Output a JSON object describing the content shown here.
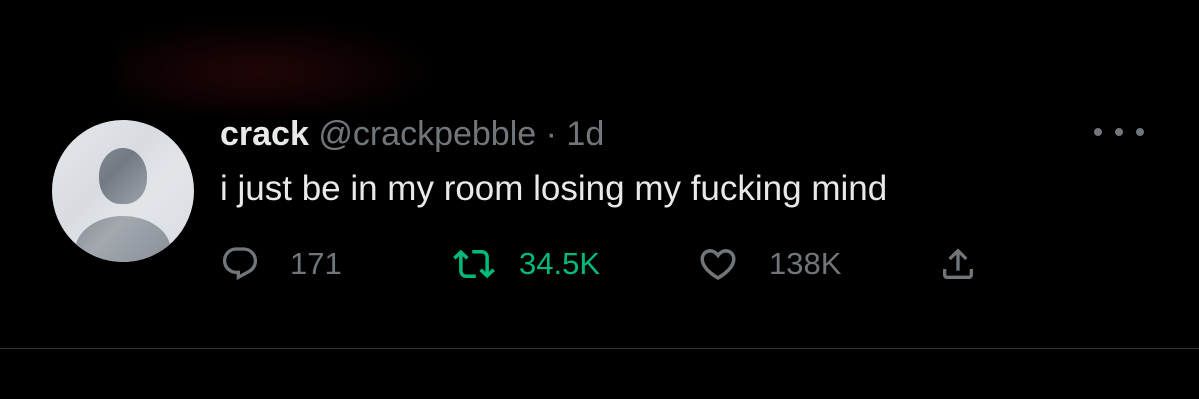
{
  "tweet": {
    "display_name": "crack",
    "handle": "@crackpebble",
    "separator": "·",
    "time": "1d",
    "text": "i just be in my room losing my fucking mind"
  },
  "actions": {
    "reply_count": "171",
    "retweet_count": "34.5K",
    "like_count": "138K"
  },
  "icons": {
    "reply": "reply-icon",
    "retweet": "retweet-icon",
    "like": "heart-icon",
    "share": "share-icon",
    "more": "more-icon"
  },
  "colors": {
    "background": "#000000",
    "primary_text": "#e7e9ea",
    "secondary_text": "#71767b",
    "retweet_active": "#00ba7c",
    "divider": "#2f3336"
  }
}
